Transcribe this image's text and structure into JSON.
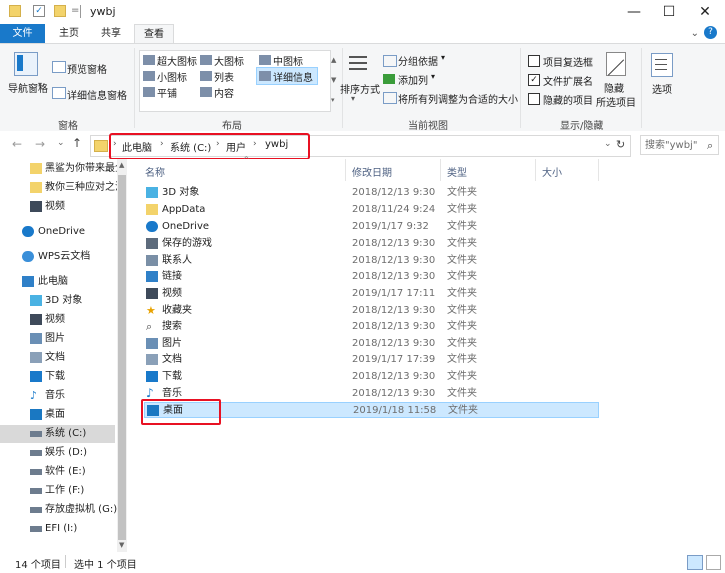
{
  "window": {
    "title": "ywbj"
  },
  "tabs": [
    "文件",
    "主页",
    "共享",
    "查看"
  ],
  "ribbon": {
    "panes": {
      "nav_pane": "导航窗格",
      "preview_pane": "预览窗格",
      "details_pane": "详细信息窗格",
      "group_label": "窗格"
    },
    "layout": {
      "items": [
        "超大图标",
        "大图标",
        "中图标",
        "小图标",
        "列表",
        "详细信息",
        "平铺",
        "内容"
      ],
      "group_label": "布局"
    },
    "current_view": {
      "sort_by": "排序方式",
      "group_by": "分组依据",
      "add_column": "添加列",
      "fit_columns": "将所有列调整为合适的大小",
      "group_label": "当前视图"
    },
    "show_hide": {
      "item_checkboxes": "项目复选框",
      "file_extensions": "文件扩展名",
      "hidden_items": "隐藏的项目",
      "hide_selected": "隐藏",
      "hide_selected2": "所选项目",
      "group_label": "显示/隐藏"
    },
    "options": "选项"
  },
  "address": {
    "crumbs": [
      "此电脑",
      "系统 (C:)",
      "用户",
      "ywbj"
    ],
    "search_placeholder": "搜索\"ywbj\""
  },
  "nav": [
    "黑鲨为你带来最全",
    "教你三种应对之法",
    "视频",
    "OneDrive",
    "WPS云文档",
    "此电脑",
    "3D 对象",
    "视频",
    "图片",
    "文档",
    "下载",
    "音乐",
    "桌面",
    "系统 (C:)",
    "娱乐 (D:)",
    "软件 (E:)",
    "工作 (F:)",
    "存放虚拟机 (G:)",
    "EFI (I:)"
  ],
  "columns": [
    "名称",
    "修改日期",
    "类型",
    "大小"
  ],
  "files": [
    {
      "name": "3D 对象",
      "date": "2018/12/13 9:30",
      "type": "文件夹"
    },
    {
      "name": "AppData",
      "date": "2018/11/24 9:24",
      "type": "文件夹"
    },
    {
      "name": "OneDrive",
      "date": "2019/1/17 9:32",
      "type": "文件夹"
    },
    {
      "name": "保存的游戏",
      "date": "2018/12/13 9:30",
      "type": "文件夹"
    },
    {
      "name": "联系人",
      "date": "2018/12/13 9:30",
      "type": "文件夹"
    },
    {
      "name": "链接",
      "date": "2018/12/13 9:30",
      "type": "文件夹"
    },
    {
      "name": "视频",
      "date": "2019/1/17 17:11",
      "type": "文件夹"
    },
    {
      "name": "收藏夹",
      "date": "2018/12/13 9:30",
      "type": "文件夹"
    },
    {
      "name": "搜索",
      "date": "2018/12/13 9:30",
      "type": "文件夹"
    },
    {
      "name": "图片",
      "date": "2018/12/13 9:30",
      "type": "文件夹"
    },
    {
      "name": "文档",
      "date": "2019/1/17 17:39",
      "type": "文件夹"
    },
    {
      "name": "下载",
      "date": "2018/12/13 9:30",
      "type": "文件夹"
    },
    {
      "name": "音乐",
      "date": "2018/12/13 9:30",
      "type": "文件夹"
    },
    {
      "name": "桌面",
      "date": "2019/1/18 11:58",
      "type": "文件夹"
    }
  ],
  "status": {
    "count": "14 个项目",
    "selected": "选中 1 个项目"
  },
  "colors": {
    "accent": "#1979ca",
    "selected_row": "#cce8ff",
    "highlight": "#e81123"
  }
}
